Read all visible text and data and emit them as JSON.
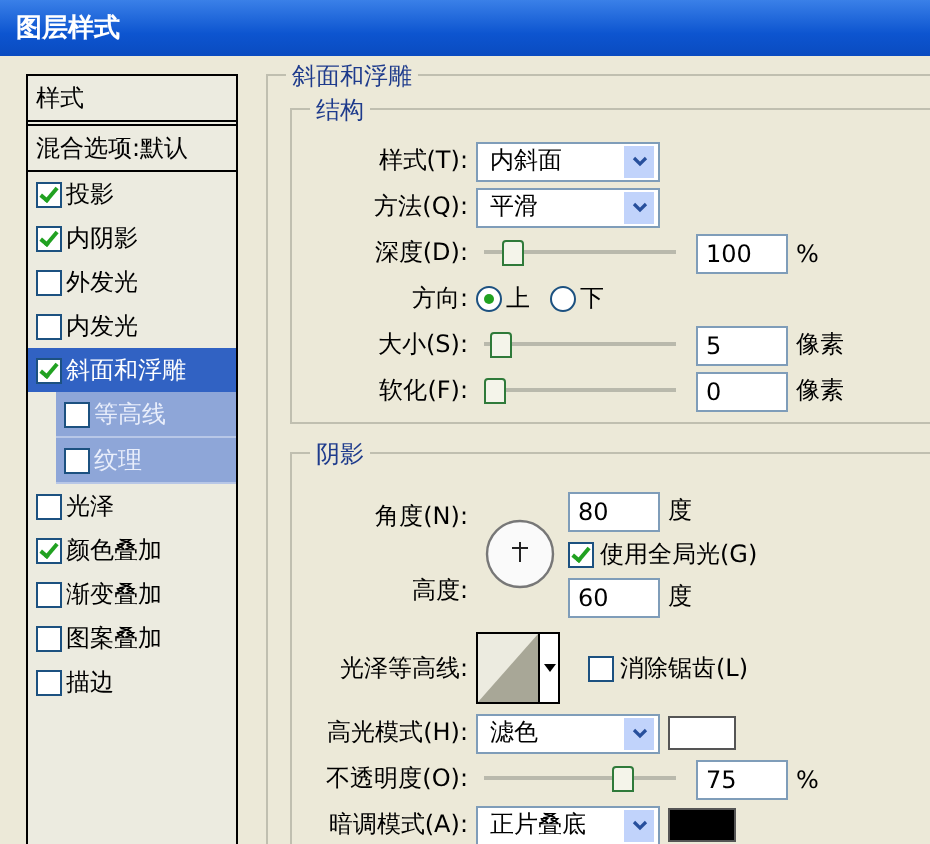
{
  "window": {
    "title": "图层样式"
  },
  "sidebar": {
    "header": "样式",
    "blend_options": "混合选项:默认",
    "items": [
      {
        "label": "投影",
        "checked": true,
        "selected": false
      },
      {
        "label": "内阴影",
        "checked": true,
        "selected": false
      },
      {
        "label": "外发光",
        "checked": false,
        "selected": false
      },
      {
        "label": "内发光",
        "checked": false,
        "selected": false
      },
      {
        "label": "斜面和浮雕",
        "checked": true,
        "selected": true,
        "children": [
          {
            "label": "等高线",
            "checked": false
          },
          {
            "label": "纹理",
            "checked": false
          }
        ]
      },
      {
        "label": "光泽",
        "checked": false,
        "selected": false
      },
      {
        "label": "颜色叠加",
        "checked": true,
        "selected": false
      },
      {
        "label": "渐变叠加",
        "checked": false,
        "selected": false
      },
      {
        "label": "图案叠加",
        "checked": false,
        "selected": false
      },
      {
        "label": "描边",
        "checked": false,
        "selected": false
      }
    ]
  },
  "panel": {
    "title": "斜面和浮雕",
    "structure": {
      "title": "结构",
      "rows": [
        {
          "kind": "select",
          "label": "样式(T):",
          "value": "内斜面"
        },
        {
          "kind": "select",
          "label": "方法(Q):",
          "value": "平滑"
        },
        {
          "kind": "slider",
          "label": "深度(D):",
          "level": 0.1,
          "value": "100",
          "unit": "%"
        },
        {
          "kind": "radio",
          "label": "方向:",
          "options": [
            {
              "label": "上",
              "selected": true
            },
            {
              "label": "下",
              "selected": false
            }
          ]
        },
        {
          "kind": "slider",
          "label": "大小(S):",
          "level": 0.03,
          "value": "5",
          "unit": "像素"
        },
        {
          "kind": "slider",
          "label": "软化(F):",
          "level": 0,
          "value": "0",
          "unit": "像素"
        }
      ]
    },
    "shading": {
      "title": "阴影",
      "angle": {
        "label": "角度(N):",
        "value": "80",
        "unit": "度"
      },
      "global_light": {
        "label": "使用全局光(G)",
        "checked": true
      },
      "altitude": {
        "label": "高度:",
        "value": "60",
        "unit": "度"
      },
      "gloss_contour": {
        "label": "光泽等高线:"
      },
      "anti_alias": {
        "label": "消除锯齿(L)",
        "checked": false
      },
      "rows": [
        {
          "kind": "select",
          "label": "高光模式(H):",
          "value": "滤色",
          "color": "#ffffff"
        },
        {
          "kind": "slider",
          "label": "不透明度(O):",
          "level": 0.75,
          "value": "75",
          "unit": "%"
        },
        {
          "kind": "select",
          "label": "暗调模式(A):",
          "value": "正片叠底",
          "color": "#000000"
        }
      ]
    }
  }
}
